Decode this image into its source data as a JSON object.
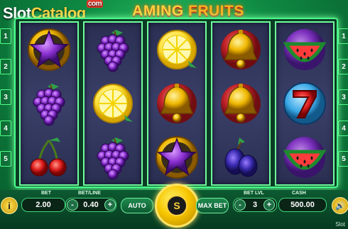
{
  "watermark": {
    "brand_a": "Slot",
    "brand_b": "Catalog",
    "domain_suffix": "com",
    "corner_text": "Slot"
  },
  "game": {
    "title_part1": "AMING",
    "title_part2": "FRUITS"
  },
  "paylines": {
    "left": [
      "1",
      "2",
      "3",
      "4",
      "5"
    ],
    "right": [
      "1",
      "2",
      "3",
      "4",
      "5"
    ]
  },
  "reels": [
    [
      "purple-star",
      "grapes",
      "cherries"
    ],
    [
      "grapes",
      "lemon",
      "grapes"
    ],
    [
      "lemon",
      "golden-bell",
      "purple-star"
    ],
    [
      "golden-bell",
      "golden-bell",
      "plums"
    ],
    [
      "watermelon",
      "lucky-seven",
      "watermelon"
    ]
  ],
  "controls": {
    "info_glyph": "i",
    "bet_label": "BET",
    "bet_value": "2.00",
    "bet_per_line_label": "BET/LINE",
    "bet_per_line_value": "0.40",
    "minus_glyph": "-",
    "plus_glyph": "+",
    "auto_label": "AUTO",
    "spin_glyph": "S",
    "max_bet_label": "MAX BET",
    "bet_level_label": "BET LVL",
    "bet_level_value": "3",
    "cash_label": "CASH",
    "cash_value": "500.00",
    "sound_glyph": "🔊"
  },
  "colors": {
    "background": "#0f8a43",
    "frame_border": "#46ff8a",
    "reel_bg": "#3a3f68",
    "accent_gold": "#f7c600"
  }
}
